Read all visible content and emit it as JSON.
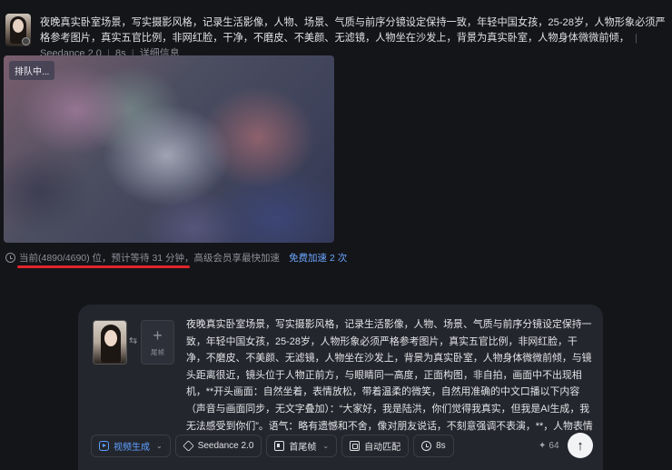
{
  "task": {
    "prompt": "夜晚真实卧室场景，写实摄影风格，记录生活影像，人物、场景、气质与前序分镜设定保持一致，年轻中国女孩，25-28岁，人物形象必须严格参考图片，真实五官比例，非网红脸，干净，不磨皮、不美颜、无滤镜，人物坐在沙发上，背景为真实卧室，人物身体微微前倾，",
    "model": "Seedance 2.0",
    "duration": "8s",
    "details_link": "详细信息",
    "queue_badge": "排队中...",
    "status_text": "当前(4890/4690) 位，预计等待 31 分钟，高级会员享最快加速",
    "accelerate_link": "免费加速 2 次"
  },
  "composer": {
    "add_endframe_label": "尾帧",
    "swap_icon": "⇆",
    "prompt": "夜晚真实卧室场景，写实摄影风格，记录生活影像，人物、场景、气质与前序分镜设定保持一致，年轻中国女孩，25-28岁，人物形象必须严格参考图片，真实五官比例，非网红脸，干净，不磨皮、不美颜、无滤镜，人物坐在沙发上，背景为真实卧室，人物身体微微前倾，与镜头距离很近，镜头位于人物正前方，与眼睛同一高度，正面构图，非自拍，画面中不出现相机，**开头画面：自然坐着，表情放松，带着温柔的微笑，自然用准确的中文口播以下内容（声音与画面同步，无文字叠加）：“大家好，我是陆洪，你们觉得我真实，但我是AI生成，我无法感受到你们”。语气：略有遗憾和不舍，像对朋友说话，不刻意强调不表演，**，人物表情自然。",
    "toolbar": {
      "mode": "视频生成",
      "model": "Seedance 2.0",
      "frames": "首尾帧",
      "match": "自动匹配",
      "duration": "8s"
    },
    "credits": "64",
    "send_icon": "↑"
  }
}
